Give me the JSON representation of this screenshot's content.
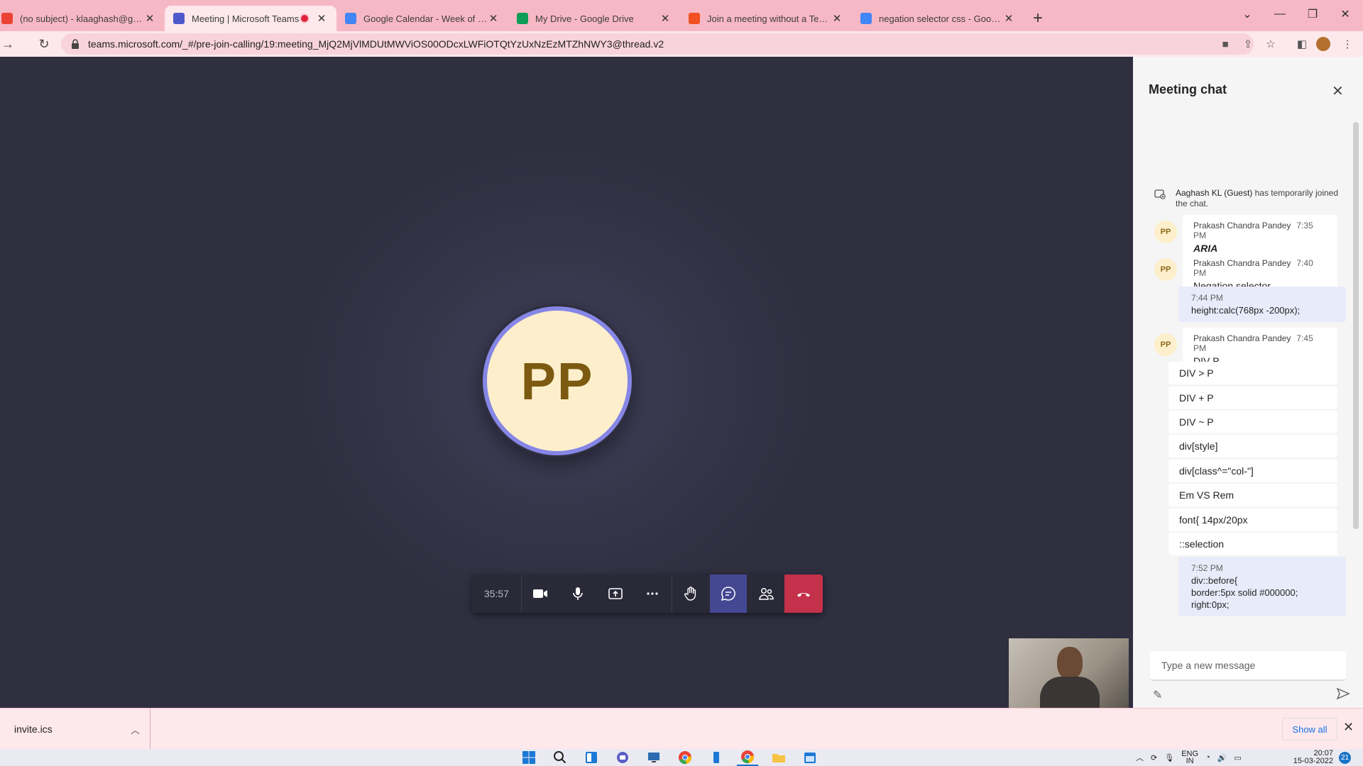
{
  "browser": {
    "tabs": [
      {
        "title": "(no subject) - klaaghash@gmail.com",
        "active": false,
        "recording": false,
        "icon": "gmail-icon",
        "color": "#ea4335"
      },
      {
        "title": "Meeting | Microsoft Teams",
        "active": true,
        "recording": true,
        "icon": "teams-icon",
        "color": "#5059c9"
      },
      {
        "title": "Google Calendar - Week of March",
        "active": false,
        "recording": false,
        "icon": "calendar-icon",
        "color": "#4285f4"
      },
      {
        "title": "My Drive - Google Drive",
        "active": false,
        "recording": false,
        "icon": "drive-icon",
        "color": "#0f9d58"
      },
      {
        "title": "Join a meeting without a Teams account",
        "active": false,
        "recording": false,
        "icon": "microsoft-icon",
        "color": "#f25022"
      },
      {
        "title": "negation selector css - Google Search",
        "active": false,
        "recording": false,
        "icon": "google-icon",
        "color": "#4285f4"
      }
    ],
    "url": "teams.microsoft.com/_#/pre-join-calling/19:meeting_MjQ2MjVlMDUtMWViOS00ODcxLWFiOTQtYzUxNzEzMTZhNWY3@thread.v2"
  },
  "call": {
    "avatar_initials": "PP",
    "timer": "35:57"
  },
  "chat": {
    "title": "Meeting chat",
    "system_message": {
      "name": "Aaghash KL (Guest)",
      "text": " has temporarily joined the chat."
    },
    "messages": [
      {
        "sender": "Prakash Chandra Pandey",
        "time": "7:35 PM",
        "text": "ARIA"
      },
      {
        "sender": "Prakash Chandra Pandey",
        "time": "7:40 PM",
        "text": "Negation selector"
      },
      {
        "own": true,
        "time": "7:44 PM",
        "text": "height:calc(768px -200px);"
      },
      {
        "sender": "Prakash Chandra Pandey",
        "time": "7:45 PM",
        "text": "DIV P"
      },
      {
        "text": "DIV > P"
      },
      {
        "text": "DIV + P"
      },
      {
        "text": "DIV ~ P"
      },
      {
        "text": "div[style]"
      },
      {
        "text": "div[class^=\"col-\"]"
      },
      {
        "text": "Em VS Rem"
      },
      {
        "text": "font{ 14px/20px"
      },
      {
        "text": "::selection"
      },
      {
        "own": true,
        "time": "7:52 PM",
        "lines": [
          "div::before{",
          "border:5px solid #000000;",
          "right:0px;"
        ]
      }
    ],
    "composer_placeholder": "Type a new message"
  },
  "downloads": {
    "file": "invite.ics",
    "show_all": "Show all"
  },
  "taskbar": {
    "lang": "ENG",
    "region": "IN",
    "time": "20:07",
    "date": "15-03-2022",
    "notifications": "21"
  }
}
